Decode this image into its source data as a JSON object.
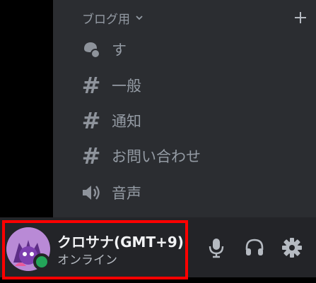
{
  "category": {
    "label": "ブログ用",
    "chevron_icon": "chevron-down-icon",
    "add_icon": "plus-icon"
  },
  "channels": [
    {
      "name": "す",
      "type": "forum",
      "icon": "forum-icon"
    },
    {
      "name": "一般",
      "type": "text",
      "icon": "hash-icon"
    },
    {
      "name": "通知",
      "type": "text",
      "icon": "hash-icon"
    },
    {
      "name": "お問い合わせ",
      "type": "text",
      "icon": "hash-icon"
    },
    {
      "name": "音声",
      "type": "voice",
      "icon": "speaker-icon"
    }
  ],
  "hash_glyph": "#",
  "user": {
    "name": "クロサナ(GMT+9)",
    "status": "オンライン",
    "status_color": "#23a559"
  },
  "controls": {
    "mic_icon": "microphone-icon",
    "headset_icon": "headphones-icon",
    "settings_icon": "gear-icon"
  },
  "colors": {
    "sidebar_bg": "#2b2d31",
    "user_bar_bg": "#232428",
    "highlight": "#ff0000",
    "muted_text": "#949ba4"
  }
}
